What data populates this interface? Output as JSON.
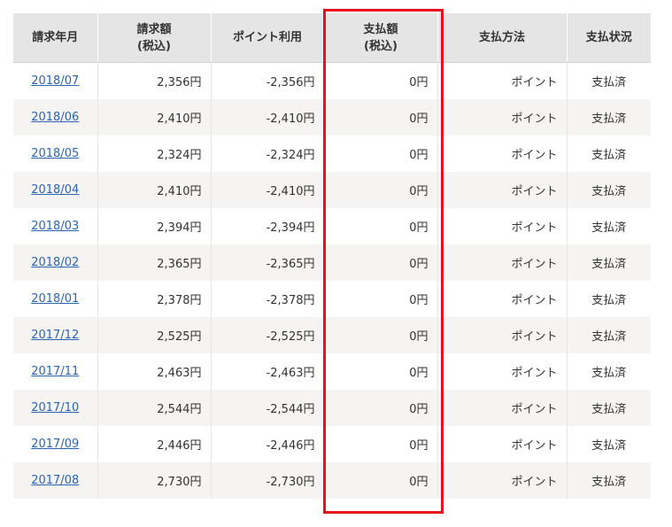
{
  "table": {
    "headers": {
      "month": "請求年月",
      "amount_line1": "請求額",
      "amount_line2": "(税込)",
      "point": "ポイント利用",
      "payment_line1": "支払額",
      "payment_line2": "(税込)",
      "method": "支払方法",
      "status": "支払状況"
    },
    "rows": [
      {
        "month": "2018/07",
        "amount": "2,356円",
        "point": "-2,356円",
        "payment": "0円",
        "method": "ポイント",
        "status": "支払済"
      },
      {
        "month": "2018/06",
        "amount": "2,410円",
        "point": "-2,410円",
        "payment": "0円",
        "method": "ポイント",
        "status": "支払済"
      },
      {
        "month": "2018/05",
        "amount": "2,324円",
        "point": "-2,324円",
        "payment": "0円",
        "method": "ポイント",
        "status": "支払済"
      },
      {
        "month": "2018/04",
        "amount": "2,410円",
        "point": "-2,410円",
        "payment": "0円",
        "method": "ポイント",
        "status": "支払済"
      },
      {
        "month": "2018/03",
        "amount": "2,394円",
        "point": "-2,394円",
        "payment": "0円",
        "method": "ポイント",
        "status": "支払済"
      },
      {
        "month": "2018/02",
        "amount": "2,365円",
        "point": "-2,365円",
        "payment": "0円",
        "method": "ポイント",
        "status": "支払済"
      },
      {
        "month": "2018/01",
        "amount": "2,378円",
        "point": "-2,378円",
        "payment": "0円",
        "method": "ポイント",
        "status": "支払済"
      },
      {
        "month": "2017/12",
        "amount": "2,525円",
        "point": "-2,525円",
        "payment": "0円",
        "method": "ポイント",
        "status": "支払済"
      },
      {
        "month": "2017/11",
        "amount": "2,463円",
        "point": "-2,463円",
        "payment": "0円",
        "method": "ポイント",
        "status": "支払済"
      },
      {
        "month": "2017/10",
        "amount": "2,544円",
        "point": "-2,544円",
        "payment": "0円",
        "method": "ポイント",
        "status": "支払済"
      },
      {
        "month": "2017/09",
        "amount": "2,446円",
        "point": "-2,446円",
        "payment": "0円",
        "method": "ポイント",
        "status": "支払済"
      },
      {
        "month": "2017/08",
        "amount": "2,730円",
        "point": "-2,730円",
        "payment": "0円",
        "method": "ポイント",
        "status": "支払済"
      }
    ]
  },
  "colors": {
    "link": "#2a65b3",
    "header_bg": "#e5e5e5",
    "stripe_bg": "#f6f4f2",
    "highlight_border": "#e8101e"
  }
}
